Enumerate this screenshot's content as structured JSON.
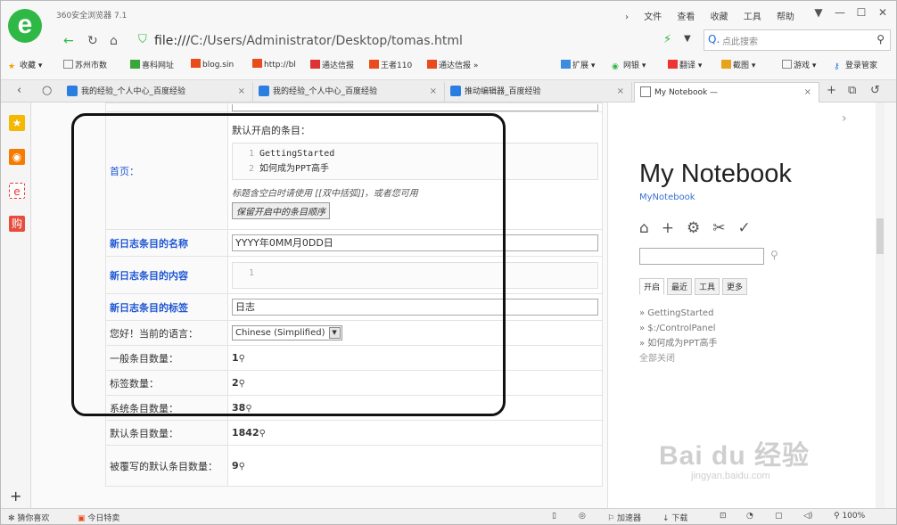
{
  "browser": {
    "app_name": "360安全浏览器 7.1",
    "menu": [
      "文件",
      "查看",
      "收藏",
      "工具",
      "帮助"
    ],
    "window_controls": [
      "down-arrow-icon",
      "minimize-icon",
      "maximize-icon",
      "close-icon"
    ]
  },
  "address": {
    "url_scheme": "file:///",
    "url_path": "C:/Users/Administrator/Desktop/tomas.html",
    "search_placeholder": "点此搜索",
    "search_letter": "Q."
  },
  "bookmarks": {
    "left": [
      "收藏",
      "苏州市数",
      "喜科网址",
      "blog.sin",
      "http://bl",
      "通达信报",
      "王者110",
      "通达信报"
    ],
    "right": [
      "扩展",
      "网银",
      "翻译",
      "截图",
      "游戏",
      "登录管家"
    ]
  },
  "tabs": [
    {
      "label": "我的经验_个人中心_百度经验"
    },
    {
      "label": "我的经验_个人中心_百度经验"
    },
    {
      "label": "推动编辑器_百度经验"
    },
    {
      "label": "My Notebook —"
    }
  ],
  "settings": {
    "home_label": "首页：",
    "home_intro": "默认开启的条目：",
    "home_items": [
      {
        "line": "1",
        "text": "GettingStarted"
      },
      {
        "line": "2",
        "text": "如何成为PPT高手"
      }
    ],
    "home_note": "标题含空白时请使用 [[双中括弧]]，或者您可用",
    "home_button": "保留开启中的条目顺序",
    "journal_name_label": "新日志条目的名称",
    "journal_name_value": "YYYY年0MM月0DD日",
    "journal_content_label": "新日志条目的内容",
    "journal_content_line": "1",
    "journal_tags_label": "新日志条目的标签",
    "journal_tags_value": "日志",
    "language_label": "您好！当前的语言：",
    "language_value": "Chinese (Simplified)",
    "rows": [
      {
        "label": "一般条目数量：",
        "value": "1"
      },
      {
        "label": "标签数量：",
        "value": "2"
      },
      {
        "label": "系统条目数量：",
        "value": "38"
      },
      {
        "label": "默认条目数量：",
        "value": "1842"
      }
    ],
    "overridden_label": "被覆写的默认条目数量：",
    "overridden_value": "9"
  },
  "notebook": {
    "title": "My Notebook",
    "subtitle": "MyNotebook",
    "tabs": [
      "开启",
      "最近",
      "工具",
      "更多"
    ],
    "open_items": [
      "GettingStarted",
      "$:/ControlPanel",
      "如何成为PPT高手"
    ],
    "close_all": "全部关闭"
  },
  "watermark": {
    "main": "Bai du 经验",
    "sub": "jingyan.baidu.com"
  },
  "statusbar": {
    "left": [
      "猜你喜欢",
      "今日特卖"
    ],
    "accelerator": "加速器",
    "download": "下载",
    "zoom": "100%"
  }
}
